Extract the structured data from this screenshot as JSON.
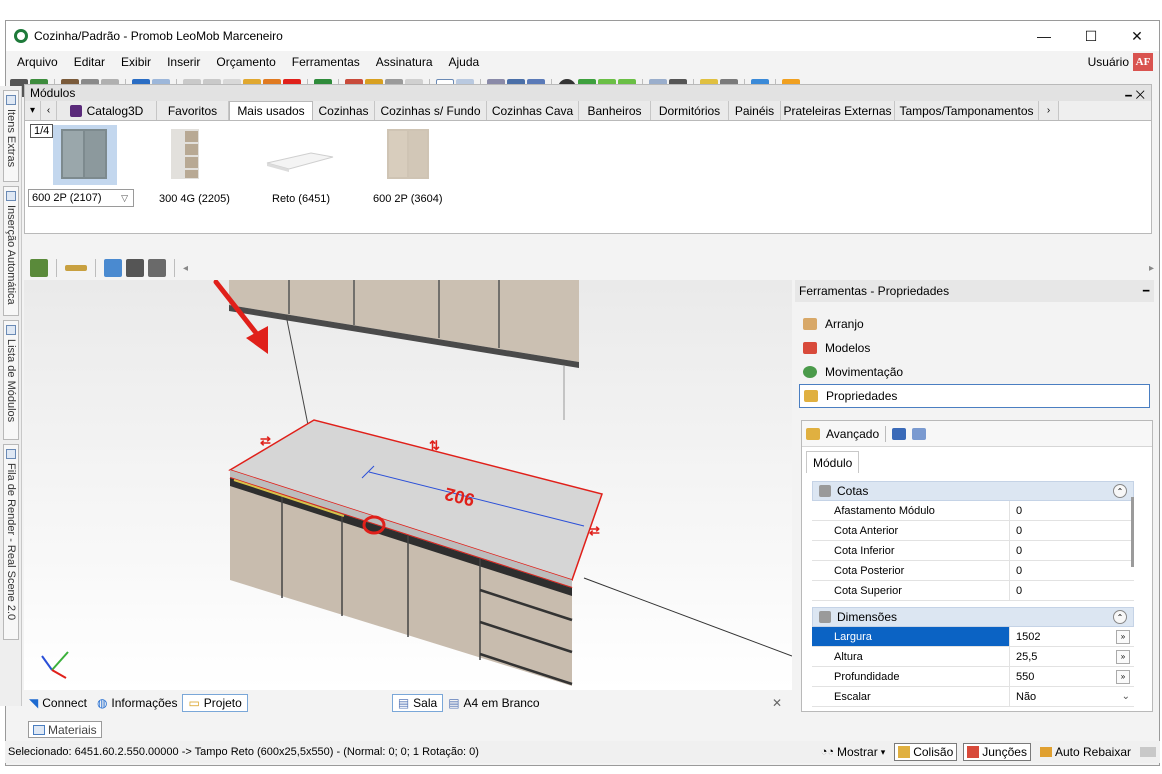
{
  "window": {
    "title": "Cozinha/Padrão - Promob LeoMob Marceneiro",
    "controls": {
      "minimize": "—",
      "maximize": "☐",
      "close": "✕"
    }
  },
  "menu": {
    "items": [
      "Arquivo",
      "Editar",
      "Exibir",
      "Inserir",
      "Orçamento",
      "Ferramentas",
      "Assinatura",
      "Ajuda"
    ],
    "user_label": "Usuário",
    "user_initials": "AF"
  },
  "side_rail": {
    "tabs": [
      "Itens Extras",
      "Inserção Automática",
      "Lista de Módulos",
      "Fila de Render - Real Scene 2.0"
    ]
  },
  "modulos": {
    "title": "Módulos",
    "pin": "🗕 ✕",
    "tabs": [
      "Catalog3D",
      "Favoritos",
      "Mais usados",
      "Cozinhas",
      "Cozinhas s/ Fundo",
      "Cozinhas Cava",
      "Banheiros",
      "Dormitórios",
      "Painéis",
      "Prateleiras Externas",
      "Tampos/Tamponamentos"
    ],
    "active_tab": "Mais usados",
    "page_badge": "1/4",
    "items": [
      {
        "label": "600 2P (2107)",
        "selected": true
      },
      {
        "label": "300 4G (2205)"
      },
      {
        "label": "Reto (6451)"
      },
      {
        "label": "600 2P (3604)"
      }
    ]
  },
  "viewport": {
    "dimension_label": "902",
    "tabs": {
      "connect": "Connect",
      "informacoes": "Informações",
      "projeto": "Projeto",
      "sala": "Sala",
      "a4": "A4 em Branco",
      "close": "✕"
    }
  },
  "properties_panel": {
    "title": "Ferramentas - Propriedades",
    "nav": [
      "Arranjo",
      "Modelos",
      "Movimentação",
      "Propriedades"
    ],
    "active_nav": "Propriedades",
    "advanced_label": "Avançado",
    "modulo_tab": "Módulo",
    "groups": [
      {
        "name": "Cotas",
        "rows": [
          {
            "name": "Afastamento Módulo",
            "value": "0"
          },
          {
            "name": "Cota Anterior",
            "value": "0"
          },
          {
            "name": "Cota Inferior",
            "value": "0"
          },
          {
            "name": "Cota Posterior",
            "value": "0"
          },
          {
            "name": "Cota Superior",
            "value": "0"
          }
        ]
      },
      {
        "name": "Dimensões",
        "rows": [
          {
            "name": "Largura",
            "value": "1502",
            "selected": true
          },
          {
            "name": "Altura",
            "value": "25,5"
          },
          {
            "name": "Profundidade",
            "value": "550"
          },
          {
            "name": "Escalar",
            "value": "Não"
          }
        ]
      }
    ]
  },
  "bottom": {
    "materiais": "Materiais",
    "status": "Selecionado: 6451.60.2.550.00000 -> Tampo Reto (600x25,5x550) - (Normal: 0; 0; 1 Rotação: 0)",
    "mostrar": "Mostrar",
    "colisao": "Colisão",
    "juncoes": "Junções",
    "auto_rebaixar": "Auto Rebaixar"
  },
  "colors": {
    "accent_blue": "#0b63c4",
    "selection_red": "#e0201a",
    "cabinet_beige": "#c8bcae",
    "countertop_grey": "#d8d8d8"
  }
}
